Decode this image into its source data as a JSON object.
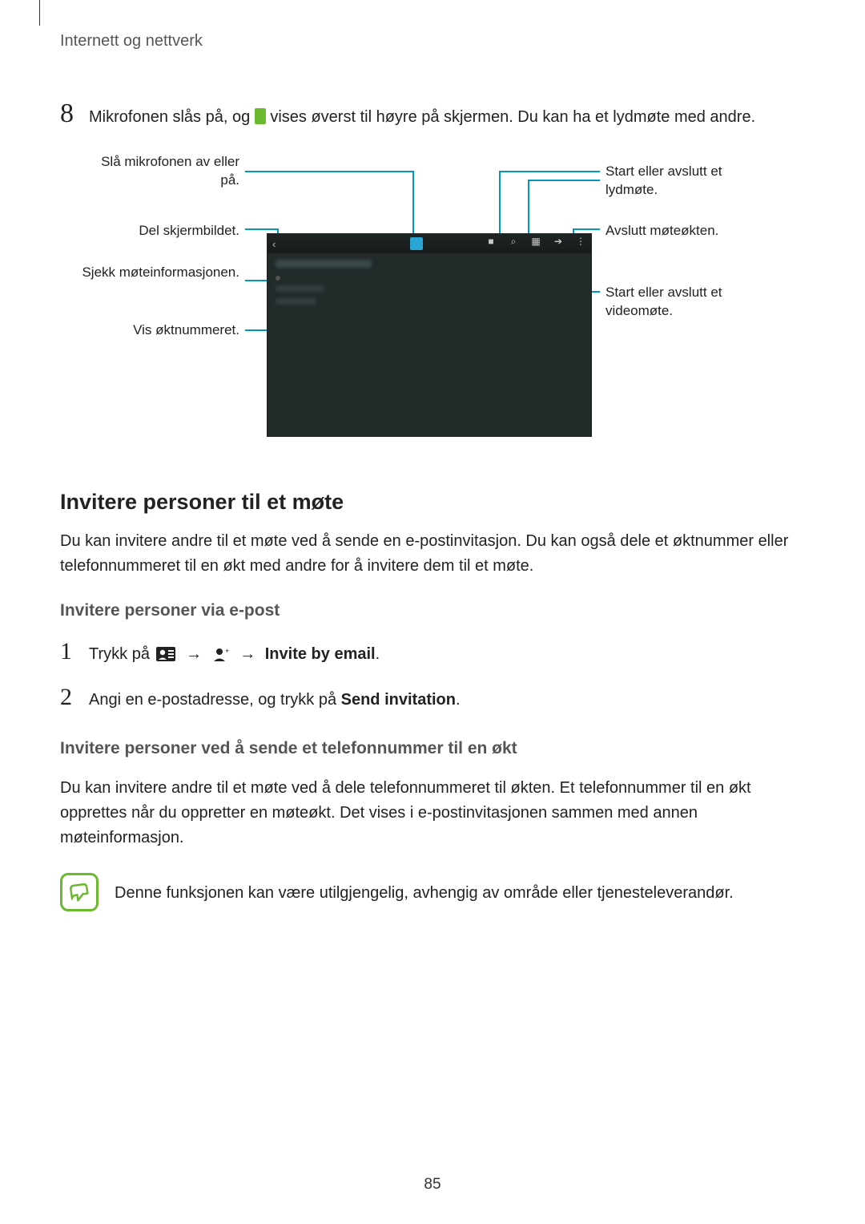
{
  "breadcrumb": "Internett og nettverk",
  "step8": {
    "num": "8",
    "text_before": "Mikrofonen slås på, og ",
    "text_after": " vises øverst til høyre på skjermen. Du kan ha et lydmøte med andre."
  },
  "callouts": {
    "left1": "Slå mikrofonen av eller på.",
    "left2": "Del skjermbildet.",
    "left3": "Sjekk møteinformasjonen.",
    "left4": "Vis øktnummeret.",
    "right1": "Start eller avslutt et lydmøte.",
    "right2": "Avslutt møteøkten.",
    "right3": "Start eller avslutt et videomøte."
  },
  "section_title": "Invitere personer til et møte",
  "section_intro": "Du kan invitere andre til et møte ved å sende en e-postinvitasjon. Du kan også dele et øktnummer eller telefonnummeret til en økt med andre for å invitere dem til et møte.",
  "sub_email": "Invitere personer via e-post",
  "step1": {
    "num": "1",
    "prefix": "Trykk på ",
    "arrow": "→",
    "bold": "Invite by email",
    "suffix": "."
  },
  "step2": {
    "num": "2",
    "prefix": "Angi en e-postadresse, og trykk på ",
    "bold": "Send invitation",
    "suffix": "."
  },
  "sub_phone": "Invitere personer ved å sende et telefonnummer til en økt",
  "phone_para": "Du kan invitere andre til et møte ved å dele telefonnummeret til økten. Et telefonnummer til en økt opprettes når du oppretter en møteøkt. Det vises i e-postinvitasjonen sammen med annen møteinformasjon.",
  "note": "Denne funksjonen kan være utilgjengelig, avhengig av område eller tjenesteleverandør.",
  "page_number": "85"
}
